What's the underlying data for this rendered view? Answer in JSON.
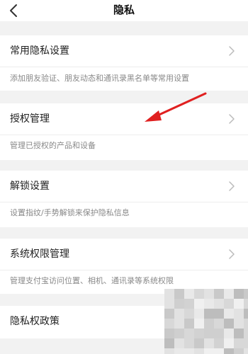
{
  "nav": {
    "title": "隐私"
  },
  "items": [
    {
      "label": "常用隐私设置",
      "desc": "添加朋友验证、朋友动态和通讯录黑名单等常用设置"
    },
    {
      "label": "授权管理",
      "desc": "管理已授权的产品和设备"
    },
    {
      "label": "解锁设置",
      "desc": "设置指纹/手势解锁来保护隐私信息"
    },
    {
      "label": "系统权限管理",
      "desc": "管理支付宝访问位置、相机、通讯录等系统权限"
    },
    {
      "label": "隐私权政策"
    }
  ],
  "colors": {
    "background": "#f2f2f2",
    "surface": "#ffffff",
    "text": "#222222",
    "secondary_text": "#888888",
    "chevron": "#bbbbbb",
    "annotation_arrow": "#e02020"
  },
  "icons": {
    "back": "back-chevron-icon",
    "row_chevron": "chevron-right-icon",
    "annotation": "red-arrow-icon"
  }
}
